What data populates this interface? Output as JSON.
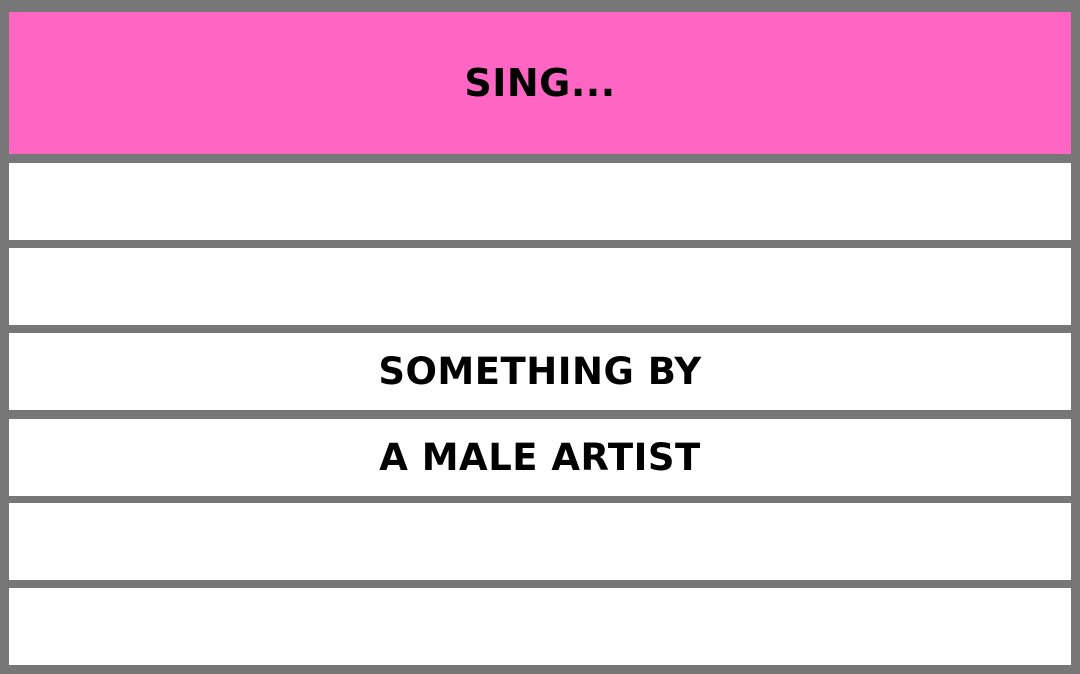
{
  "header": {
    "title": "SING...",
    "background": "#FF66C4"
  },
  "rows": [
    {
      "text": ""
    },
    {
      "text": ""
    },
    {
      "text": "SOMETHING BY"
    },
    {
      "text": "A MALE ARTIST"
    },
    {
      "text": ""
    },
    {
      "text": ""
    }
  ],
  "colors": {
    "frame": "#777777",
    "row": "#FFFFFF",
    "text": "#000000"
  }
}
